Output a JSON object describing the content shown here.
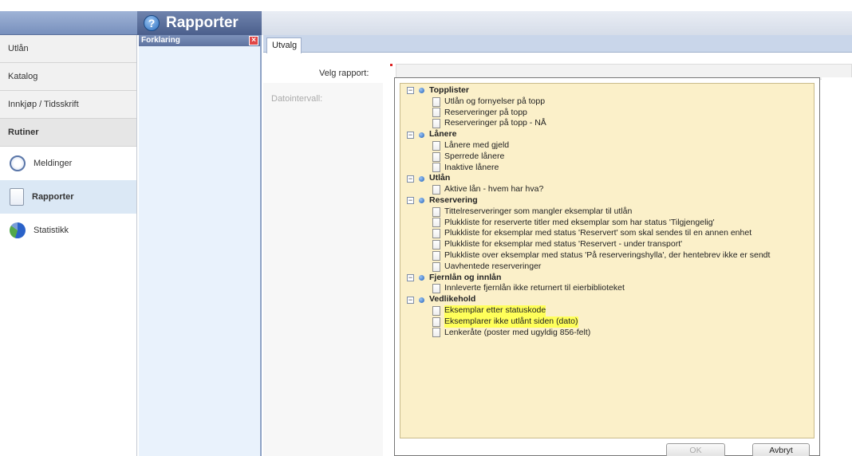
{
  "app": {
    "title": "Rapporter",
    "help_icon": "?"
  },
  "nav": {
    "items": [
      {
        "label": "Utlån"
      },
      {
        "label": "Katalog"
      },
      {
        "label": "Innkjøp / Tidsskrift"
      }
    ],
    "section": "Rutiner",
    "sub": [
      {
        "label": "Meldinger",
        "icon": "message-icon"
      },
      {
        "label": "Rapporter",
        "icon": "report-icon",
        "active": true
      },
      {
        "label": "Statistikk",
        "icon": "statistics-icon"
      }
    ]
  },
  "forklaring": {
    "title": "Forklaring",
    "close": "×"
  },
  "main": {
    "tab": "Utvalg",
    "velg_rapport_label": "Velg rapport:",
    "datointervall_label": "Datointervall:"
  },
  "report_tree": {
    "groups": [
      {
        "label": "Topplister",
        "items": [
          "Utlån og fornyelser på topp",
          "Reserveringer på topp",
          "Reserveringer på topp - NÅ"
        ]
      },
      {
        "label": "Lånere",
        "items": [
          "Lånere med gjeld",
          "Sperrede lånere",
          "Inaktive lånere"
        ]
      },
      {
        "label": "Utlån",
        "items": [
          "Aktive lån - hvem har hva?"
        ]
      },
      {
        "label": "Reservering",
        "items": [
          "Tittelreserveringer som mangler eksemplar til utlån",
          "Plukkliste for reserverte titler med eksemplar som har status 'Tilgjengelig'",
          "Plukkliste for eksemplar med status 'Reservert' som skal sendes til en annen enhet",
          "Plukkliste for eksemplar med status 'Reservert - under transport'",
          "Plukkliste over eksemplar med status 'På reserveringshylla', der hentebrev ikke er sendt",
          "Uavhentede reserveringer"
        ]
      },
      {
        "label": "Fjernlån og innlån",
        "items": [
          "Innleverte fjernlån ikke returnert til eierbiblioteket"
        ]
      },
      {
        "label": "Vedlikehold",
        "items": [
          "Eksemplar etter statuskode",
          "Eksemplarer ikke utlånt siden (dato)",
          "Lenkeråte (poster med ugyldig 856-felt)"
        ]
      }
    ],
    "highlight_color": "#ffff5a"
  },
  "buttons": {
    "ok": "OK",
    "cancel": "Avbryt"
  }
}
